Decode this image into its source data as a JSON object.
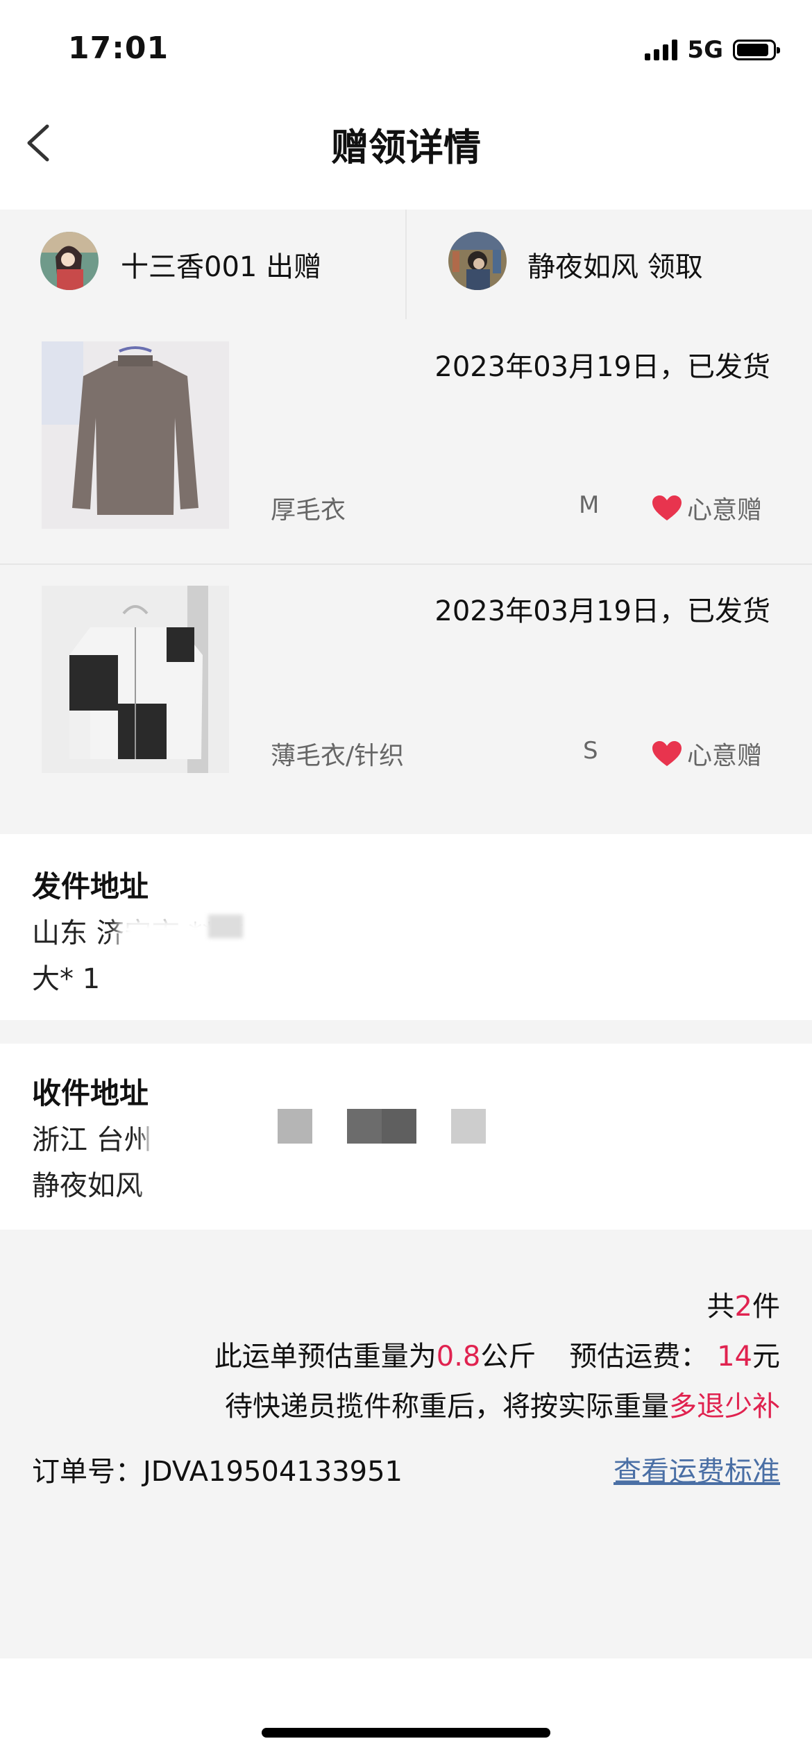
{
  "status": {
    "time": "17:01",
    "network": "5G",
    "battery_level": 0.9
  },
  "header": {
    "title": "赠领详情",
    "back_icon": "chevron-left-icon"
  },
  "participants": {
    "giver": {
      "name": "十三香001",
      "role": "出赠"
    },
    "receiver": {
      "name": "静夜如风",
      "role": "领取"
    }
  },
  "items": [
    {
      "date_status": "2023年03月19日，已发货",
      "name": "厚毛衣",
      "size": "M",
      "tag": "心意赠",
      "tag_icon": "heart-icon"
    },
    {
      "date_status": "2023年03月19日，已发货",
      "name": "薄毛衣/针织",
      "size": "S",
      "tag": "心意赠",
      "tag_icon": "heart-icon"
    }
  ],
  "sender_address": {
    "title": "发件地址",
    "line1": "山东 济宁市 ****",
    "line2": "大* 1"
  },
  "receiver_address": {
    "title": "收件地址",
    "line1": "浙江 台州",
    "line2": "静夜如风"
  },
  "summary": {
    "count_prefix": "共",
    "count": "2",
    "count_suffix": "件",
    "weight_prefix": "此运单预估重量为",
    "weight": "0.8",
    "weight_unit": "公斤",
    "fee_label": "预估运费：",
    "fee": "14",
    "fee_unit": "元",
    "note_prefix": "待快递员揽件称重后，将按实际重量",
    "note_highlight": "多退少补"
  },
  "order": {
    "label": "订单号：",
    "number": "JDVA19504133951"
  },
  "fee_link": "查看运费标准",
  "colors": {
    "accent_red": "#e0224f",
    "link_blue": "#4a6fa5",
    "heart": "#e8344e"
  }
}
